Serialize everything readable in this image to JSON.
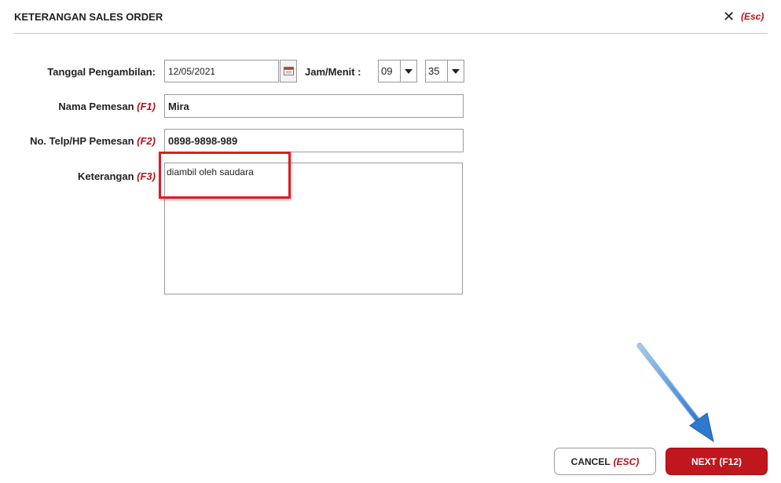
{
  "dialog": {
    "title": "KETERANGAN SALES ORDER",
    "close_symbol": "✕",
    "close_hint": "(Esc)"
  },
  "form": {
    "tanggal": {
      "label": "Tanggal Pengambilan:",
      "value": "12/05/2021",
      "calendar_icon": "calendar-icon"
    },
    "jam": {
      "label": "Jam/Menit :",
      "hour": "09",
      "minute": "35"
    },
    "nama": {
      "label": "Nama Pemesan",
      "hint": "(F1)",
      "value": "Mira"
    },
    "telp": {
      "label": "No. Telp/HP Pemesan",
      "hint": "(F2)",
      "value": "0898-9898-989"
    },
    "keterangan": {
      "label": "Keterangan",
      "hint": "(F3)",
      "value": "diambil oleh saudara"
    }
  },
  "buttons": {
    "cancel_label": "CANCEL",
    "cancel_hint": "(ESC)",
    "next_label": "NEXT (F12)"
  },
  "colors": {
    "accent_red": "#c0161d",
    "hint_red": "#b5121b",
    "highlight_box": "#e11b22",
    "annotation_arrow": "#3f86d6"
  }
}
